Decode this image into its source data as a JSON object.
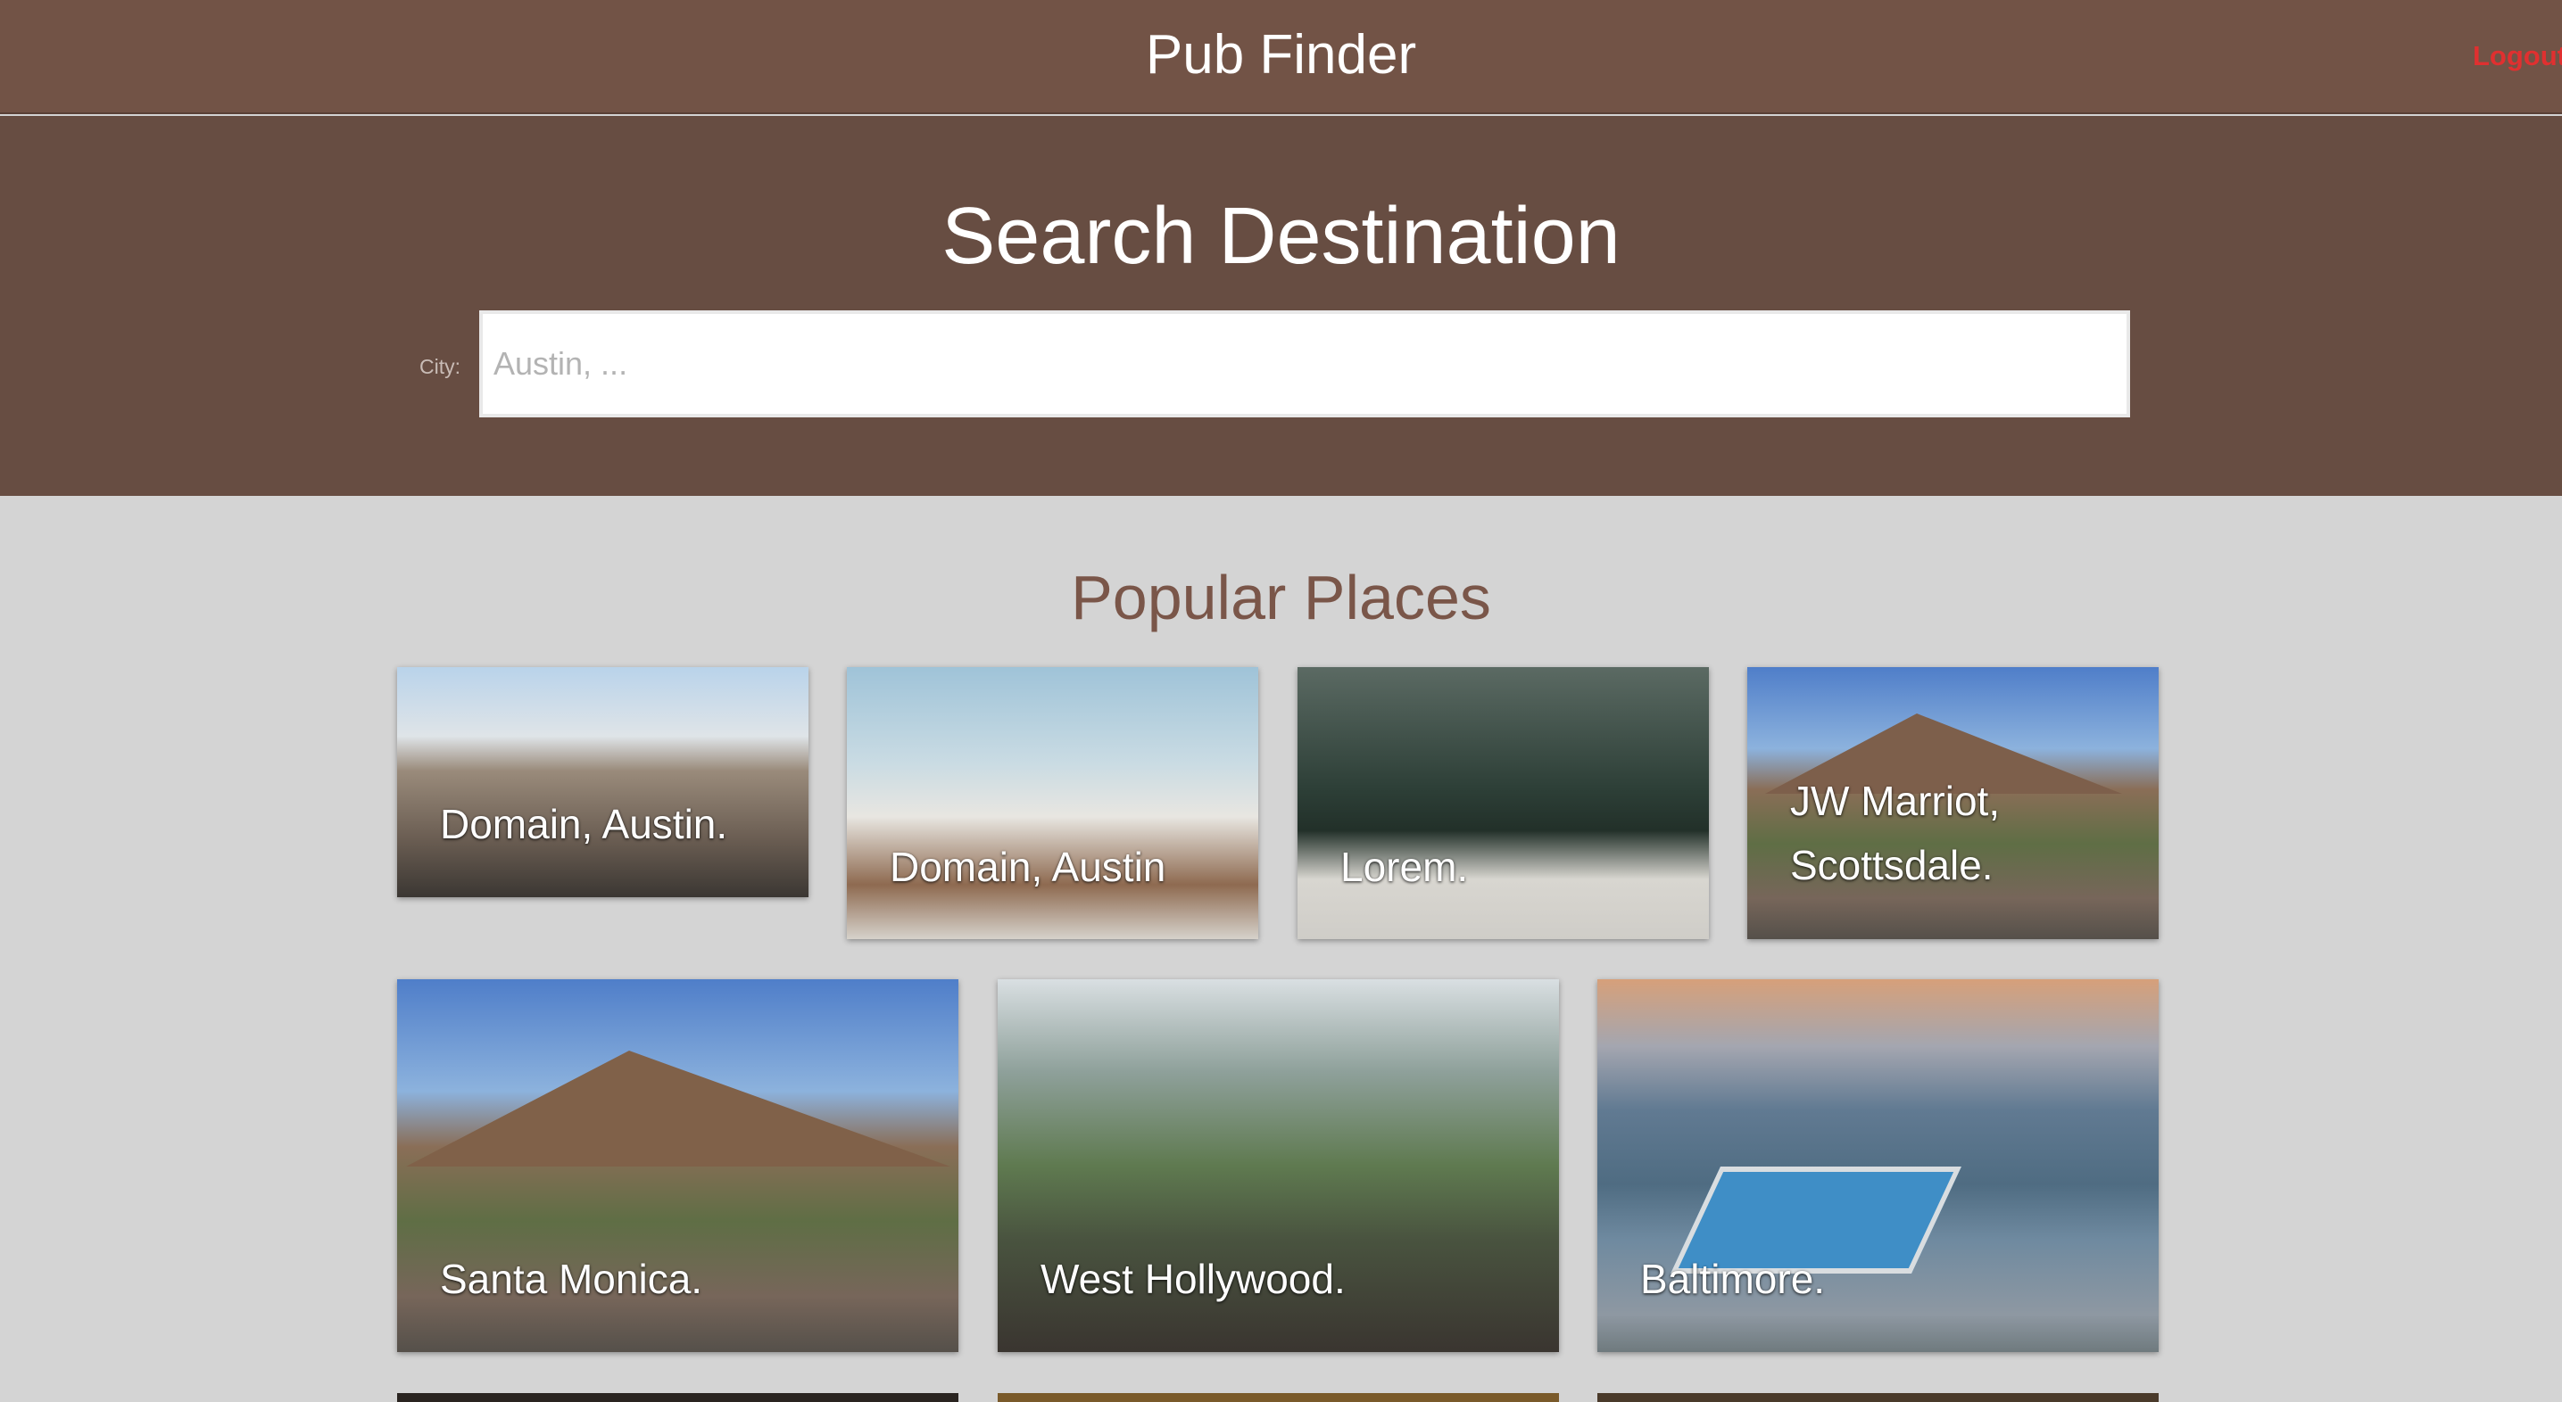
{
  "navbar": {
    "title": "Pub Finder",
    "logout_label": "Logout"
  },
  "hero": {
    "title": "Search Destination",
    "city_label": "City:",
    "city_placeholder": "Austin, ...",
    "city_value": ""
  },
  "popular": {
    "title": "Popular Places",
    "cards": [
      {
        "label": "Domain, Austin."
      },
      {
        "label": "Domain, Austin"
      },
      {
        "label": "Lorem."
      },
      {
        "label": "JW Marriot,\nScottsdale."
      },
      {
        "label": "Santa Monica."
      },
      {
        "label": "West Hollywood."
      },
      {
        "label": "Baltimore."
      }
    ]
  },
  "colors": {
    "navbar_bg": "#725346",
    "hero_bg": "#674d42",
    "page_bg": "#d4d4d4",
    "logout": "#e03030",
    "section_title": "#7a5649"
  }
}
